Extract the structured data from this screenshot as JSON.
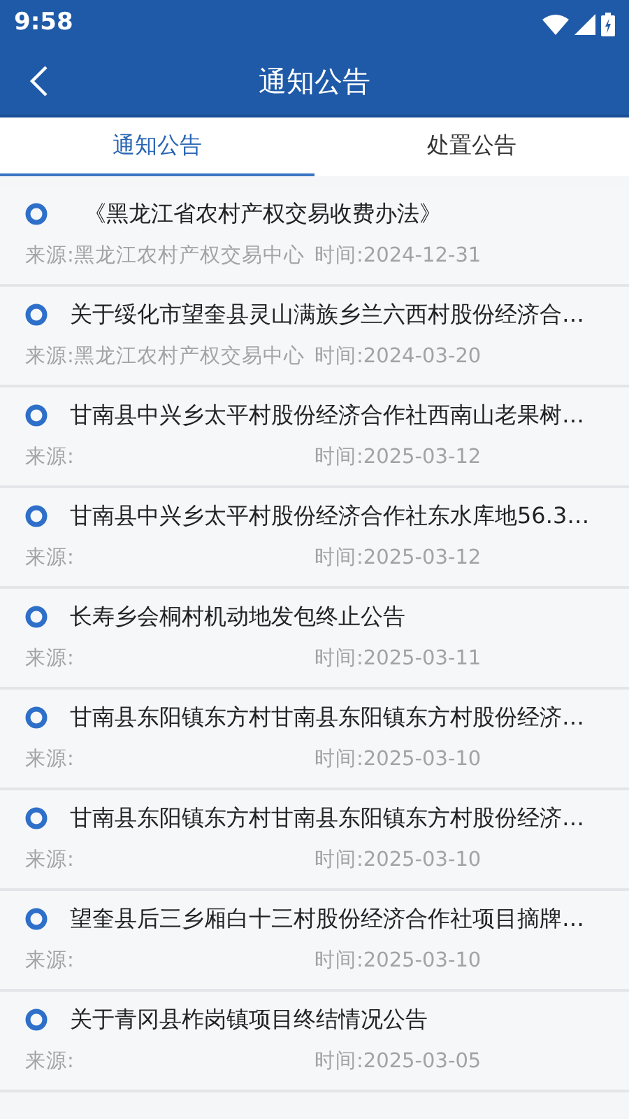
{
  "status_bar": {
    "time": "9:58"
  },
  "header": {
    "title": "通知公告"
  },
  "tabs": [
    {
      "label": "通知公告",
      "selected": true
    },
    {
      "label": "处置公告",
      "selected": false
    }
  ],
  "items": [
    {
      "title": "《黑龙江省农村产权交易收费办法》",
      "source": "来源:黑龙江农村产权交易中心",
      "time": "时间:2024-12-31"
    },
    {
      "title": "关于绥化市望奎县灵山满族乡兰六西村股份经济合…",
      "source": "来源:黑龙江农村产权交易中心",
      "time": "时间:2024-03-20"
    },
    {
      "title": "甘南县中兴乡太平村股份经济合作社西南山老果树…",
      "source": "来源:",
      "time": "时间:2025-03-12"
    },
    {
      "title": "甘南县中兴乡太平村股份经济合作社东水库地56.3…",
      "source": "来源:",
      "time": "时间:2025-03-12"
    },
    {
      "title": "长寿乡会桐村机动地发包终止公告",
      "source": "来源:",
      "time": "时间:2025-03-11"
    },
    {
      "title": "甘南县东阳镇东方村甘南县东阳镇东方村股份经济…",
      "source": "来源:",
      "time": "时间:2025-03-10"
    },
    {
      "title": "甘南县东阳镇东方村甘南县东阳镇东方村股份经济…",
      "source": "来源:",
      "time": "时间:2025-03-10"
    },
    {
      "title": "望奎县后三乡厢白十三村股份经济合作社项目摘牌…",
      "source": "来源:",
      "time": "时间:2025-03-10"
    },
    {
      "title": "关于青冈县柞岗镇项目终结情况公告",
      "source": "来源:",
      "time": "时间:2025-03-05"
    }
  ]
}
